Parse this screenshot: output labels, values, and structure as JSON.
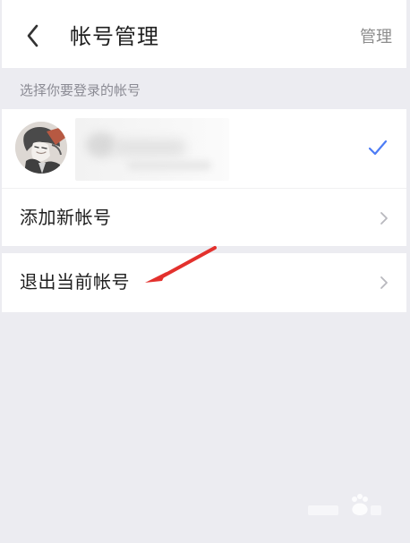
{
  "header": {
    "title": "帐号管理",
    "manage_label": "管理"
  },
  "section": {
    "label": "选择你要登录的帐号"
  },
  "account": {
    "selected": true
  },
  "menu": {
    "add_account": "添加新帐号",
    "logout_current": "退出当前帐号"
  },
  "icons": {
    "back": "back-arrow-icon",
    "check": "check-icon",
    "chevron": "chevron-right-icon",
    "avatar": "avatar-image",
    "annotation": "red-arrow-annotation",
    "watermark": "baidu-jingyan-watermark"
  },
  "colors": {
    "background": "#ececf1",
    "accent": "#4d7cf5",
    "annotation": "#e3312d"
  }
}
